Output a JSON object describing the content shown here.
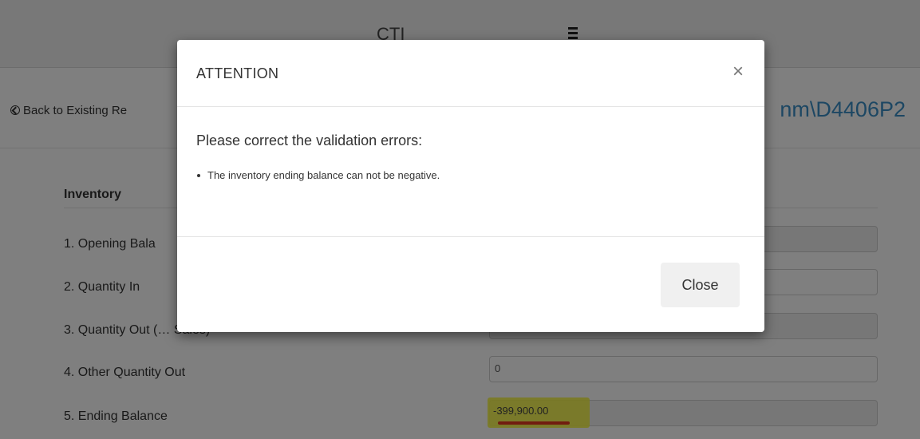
{
  "header": {
    "brand": "CTI",
    "menu_icon": "hamburger-menu-icon"
  },
  "subheader": {
    "back_link": "Back to Existing Re",
    "back_icon": "circle-chevron-left-icon",
    "record_id": "nm\\D4406P2"
  },
  "form": {
    "section_title": "Inventory",
    "rows": [
      {
        "label": "1. Opening Bala",
        "value": ""
      },
      {
        "label": "2. Quantity In",
        "value": ""
      },
      {
        "label": "3. Quantity Out (… Sales)",
        "value": ""
      },
      {
        "label": "4. Other Quantity Out",
        "value": "0"
      },
      {
        "label": "5. Ending Balance",
        "value": "-399,900.00"
      }
    ]
  },
  "modal": {
    "title": "ATTENTION",
    "close_icon": "close-icon",
    "close_glyph": "×",
    "message": "Please correct the validation errors:",
    "errors": [
      "The inventory ending balance can not be negative."
    ],
    "close_button_label": "Close"
  },
  "colors": {
    "accent": "#3a8fc7",
    "highlight": "#f6f63a",
    "underline": "#e23a1f"
  }
}
